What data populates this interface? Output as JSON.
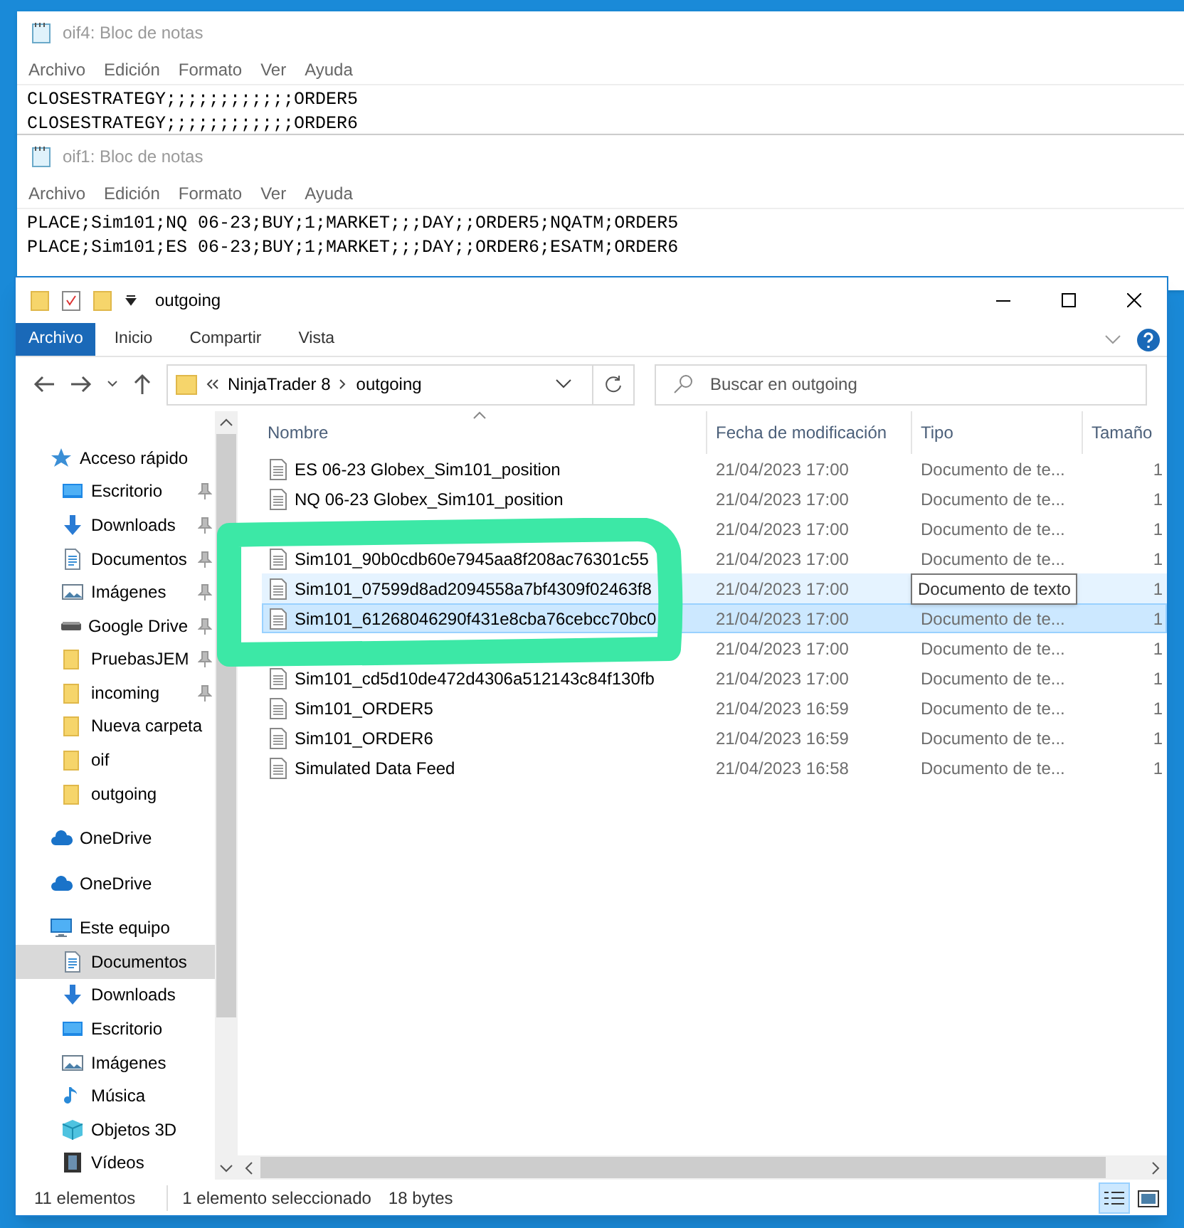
{
  "notepads": [
    {
      "title": "oif4: Bloc de notas",
      "menu": [
        "Archivo",
        "Edición",
        "Formato",
        "Ver",
        "Ayuda"
      ],
      "lines": [
        "CLOSESTRATEGY;;;;;;;;;;;;ORDER5",
        "CLOSESTRATEGY;;;;;;;;;;;;ORDER6"
      ]
    },
    {
      "title": "oif1: Bloc de notas",
      "menu": [
        "Archivo",
        "Edición",
        "Formato",
        "Ver",
        "Ayuda"
      ],
      "lines": [
        "PLACE;Sim101;NQ 06-23;BUY;1;MARKET;;;DAY;;ORDER5;NQATM;ORDER5",
        "PLACE;Sim101;ES 06-23;BUY;1;MARKET;;;DAY;;ORDER6;ESATM;ORDER6"
      ]
    }
  ],
  "explorer": {
    "title": "outgoing",
    "ribbon_tabs": [
      {
        "label": "Archivo",
        "selected": true
      },
      {
        "label": "Inicio",
        "selected": false
      },
      {
        "label": "Compartir",
        "selected": false
      },
      {
        "label": "Vista",
        "selected": false
      }
    ],
    "breadcrumb": [
      "NinjaTrader 8",
      "outgoing"
    ],
    "search": {
      "placeholder": "Buscar en outgoing"
    },
    "navigation": [
      {
        "label": "Acceso rápido",
        "kind": "star",
        "children": [
          {
            "label": "Escritorio",
            "kind": "desktop",
            "pinned": true,
            "selected": false
          },
          {
            "label": "Downloads",
            "kind": "download",
            "pinned": true,
            "selected": false
          },
          {
            "label": "Documentos",
            "kind": "document",
            "pinned": true,
            "selected": false
          },
          {
            "label": "Imágenes",
            "kind": "pictures",
            "pinned": true,
            "selected": false
          },
          {
            "label": "Google Drive",
            "kind": "drive",
            "pinned": true,
            "selected": false
          },
          {
            "label": "PruebasJEM",
            "kind": "folder",
            "pinned": true,
            "selected": false
          },
          {
            "label": "incoming",
            "kind": "folder",
            "pinned": true,
            "selected": false
          },
          {
            "label": "Nueva carpeta",
            "kind": "folder",
            "pinned": false,
            "selected": false
          },
          {
            "label": "oif",
            "kind": "folder",
            "pinned": false,
            "selected": false
          },
          {
            "label": "outgoing",
            "kind": "folder",
            "pinned": false,
            "selected": false
          }
        ]
      },
      {
        "label": "OneDrive",
        "kind": "cloud"
      },
      {
        "label": "OneDrive",
        "kind": "cloud"
      },
      {
        "label": "Este equipo",
        "kind": "computer",
        "children": [
          {
            "label": "Documentos",
            "kind": "document",
            "pinned": false,
            "selected": true
          },
          {
            "label": "Downloads",
            "kind": "download",
            "pinned": false,
            "selected": false
          },
          {
            "label": "Escritorio",
            "kind": "desktop",
            "pinned": false,
            "selected": false
          },
          {
            "label": "Imágenes",
            "kind": "pictures",
            "pinned": false,
            "selected": false
          },
          {
            "label": "Música",
            "kind": "music",
            "pinned": false,
            "selected": false
          },
          {
            "label": "Objetos 3D",
            "kind": "cube",
            "pinned": false,
            "selected": false
          },
          {
            "label": "Vídeos",
            "kind": "video",
            "pinned": false,
            "selected": false
          }
        ]
      }
    ],
    "columns": [
      "Nombre",
      "Fecha de modificación",
      "Tipo",
      "Tamaño"
    ],
    "rows": [
      {
        "name": "ES 06-23 Globex_Sim101_position",
        "date": "21/04/2023 17:00",
        "type": "Documento de te...",
        "size": "1",
        "selected": false,
        "hovered": false
      },
      {
        "name": "NQ 06-23 Globex_Sim101_position",
        "date": "21/04/2023 17:00",
        "type": "Documento de te...",
        "size": "1",
        "selected": false,
        "hovered": false
      },
      {
        "date": "21/04/2023 17:00",
        "type": "Documento de te...",
        "size": "1",
        "selected": false,
        "hovered": false
      },
      {
        "name": "Sim101_90b0cdb60e7945aa8f208ac76301c55",
        "date": "21/04/2023 17:00",
        "type": "Documento de te...",
        "size": "1",
        "selected": false,
        "hovered": false
      },
      {
        "name": "Sim101_07599d8ad2094558a7bf4309f02463f8",
        "date": "21/04/2023 17:00",
        "size": "1",
        "selected": false,
        "hovered": true
      },
      {
        "name": "Sim101_61268046290f431e8cba76cebcc70bc0",
        "date": "21/04/2023 17:00",
        "type": "Documento de te...",
        "size": "1",
        "selected": true,
        "hovered": false
      },
      {
        "date": "21/04/2023 17:00",
        "type": "Documento de te...",
        "size": "1",
        "selected": false,
        "hovered": false
      },
      {
        "name": "Sim101_cd5d10de472d4306a512143c84f130fb",
        "date": "21/04/2023 17:00",
        "type": "Documento de te...",
        "size": "1",
        "selected": false,
        "hovered": false
      },
      {
        "name": "Sim101_ORDER5",
        "date": "21/04/2023 16:59",
        "type": "Documento de te...",
        "size": "1",
        "selected": false,
        "hovered": false
      },
      {
        "name": "Sim101_ORDER6",
        "date": "21/04/2023 16:59",
        "type": "Documento de te...",
        "size": "1",
        "selected": false,
        "hovered": false
      },
      {
        "name": "Simulated Data Feed",
        "date": "21/04/2023 16:58",
        "type": "Documento de te...",
        "size": "1",
        "selected": false,
        "hovered": false
      }
    ],
    "tooltip": "Documento de texto",
    "status_bar": [
      "11 elementos",
      "1 elemento seleccionado",
      "18 bytes"
    ],
    "view_buttons": [
      {
        "kind": "details",
        "selected": true
      },
      {
        "kind": "tiles",
        "selected": false
      }
    ]
  }
}
